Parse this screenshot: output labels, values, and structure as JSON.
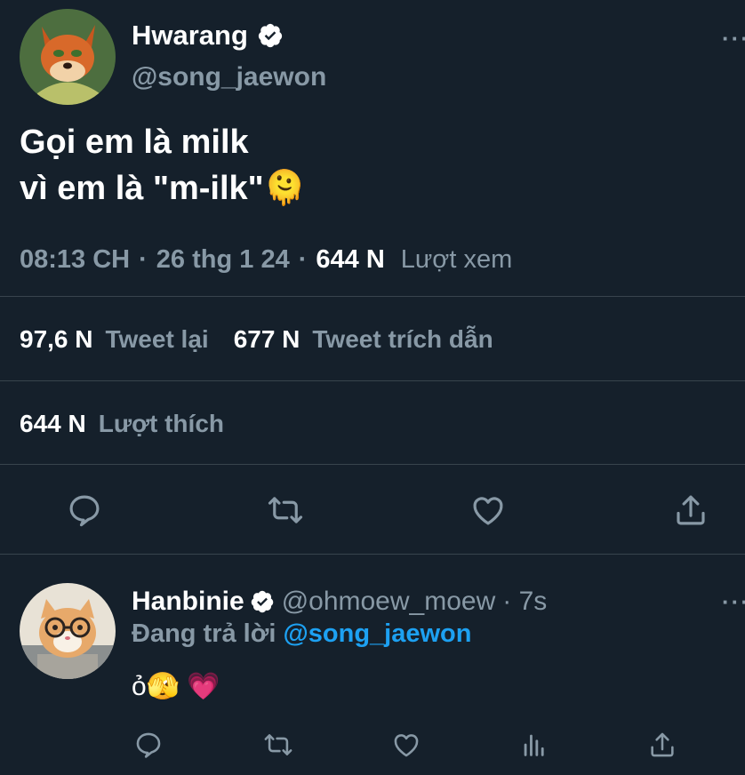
{
  "tweet": {
    "author_name": "Hwarang",
    "author_handle": "@song_jaewon",
    "more_label": "···",
    "text_line1": "Gọi em là milk",
    "text_line2": "vì em là \"m-ilk\"",
    "text_emoji": "🫠",
    "time": "08:13 CH",
    "dot1": "·",
    "date": "26 thg 1 24",
    "dot2": "·",
    "views_count": "644 N",
    "views_label": "Lượt xem",
    "retweets_count": "97,6 N",
    "retweets_label": "Tweet lại",
    "quotes_count": "677 N",
    "quotes_label": "Tweet trích dẫn",
    "likes_count": "644 N",
    "likes_label": "Lượt thích"
  },
  "reply": {
    "author_name": "Hanbinie",
    "author_handle": "@ohmoew_moew",
    "time": "· 7s",
    "more_label": "···",
    "replying_prefix": "Đang trả lời",
    "replying_mention": "@song_jaewon",
    "text": "ỏ",
    "emojis": "🫣 💗"
  },
  "colors": {
    "background": "#15202b",
    "secondary_text": "#8899a6",
    "accent": "#1da1f2",
    "divider": "#38444d"
  },
  "icons": {
    "reply": "speech-bubble-icon",
    "retweet": "retweet-icon",
    "like": "heart-icon",
    "share": "share-icon",
    "analytics": "bar-chart-icon",
    "verified": "verified-badge-icon"
  }
}
